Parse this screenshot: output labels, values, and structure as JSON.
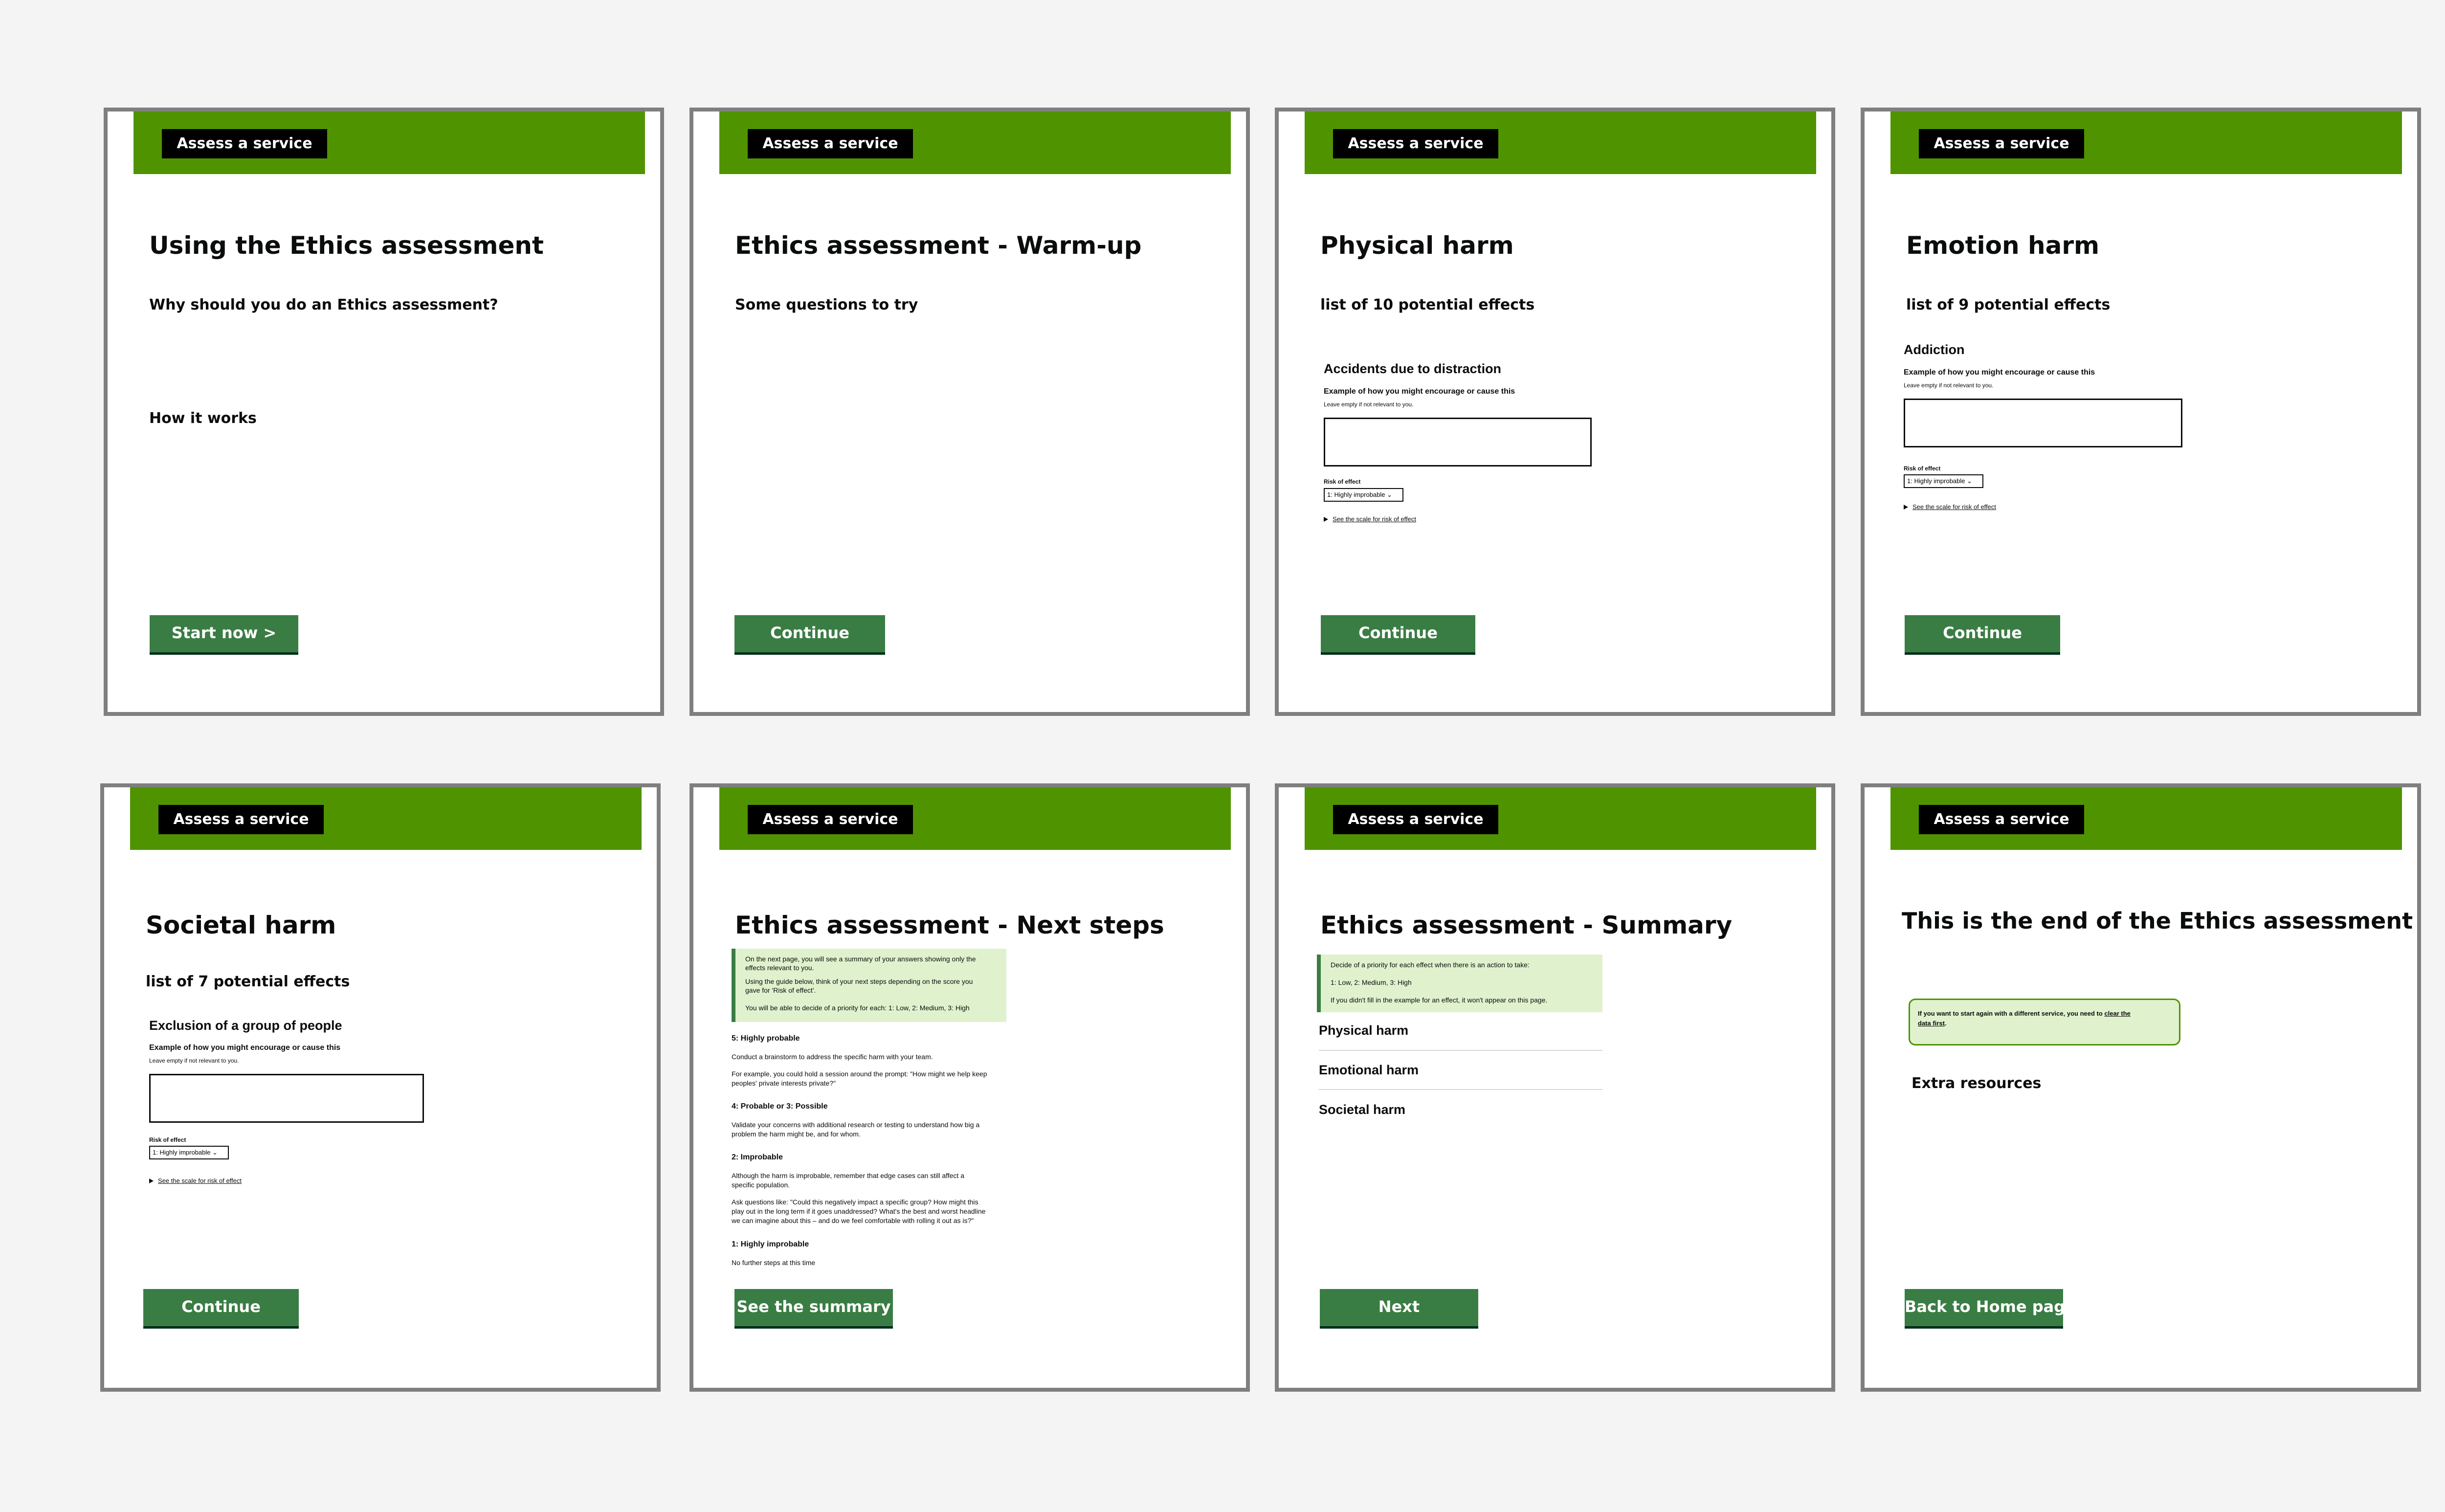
{
  "service_label": "Assess a service",
  "cards": {
    "c1": {
      "title": "Using the Ethics assessment",
      "subtitle": "Why should you do an Ethics assessment?",
      "section": "How it works",
      "button": "Start now >"
    },
    "c2": {
      "title": "Ethics assessment - Warm-up",
      "subtitle": "Some questions to try",
      "button": "Continue"
    },
    "c3": {
      "title": "Physical harm",
      "subtitle": "list of 10 potential effects",
      "effect": "Accidents due to distraction",
      "example_label": "Example of how you might encourage or cause this",
      "hint": "Leave empty if not relevant to you.",
      "risk_label": "Risk of effect",
      "risk_value": "1: Highly improbable",
      "details": "See the scale for risk of effect",
      "button": "Continue"
    },
    "c4": {
      "title": "Emotion harm",
      "subtitle": "list of 9 potential effects",
      "effect": "Addiction",
      "example_label": "Example of how you might encourage or cause this",
      "hint": "Leave empty if not relevant to you.",
      "risk_label": "Risk of effect",
      "risk_value": "1: Highly improbable",
      "details": "See the scale for risk of effect",
      "button": "Continue"
    },
    "c5": {
      "title": "Societal harm",
      "subtitle": "list of 7 potential effects",
      "effect": "Exclusion of a group of people",
      "example_label": "Example of how you might encourage or cause this",
      "hint": "Leave empty if not relevant to you.",
      "risk_label": "Risk of effect",
      "risk_value": "1: Highly improbable",
      "details": "See the scale for risk of effect",
      "button": "Continue"
    },
    "c6": {
      "title": "Ethics assessment - Next steps",
      "inset": [
        "On the next page, you will see a summary of your answers showing only the",
        "effects relevant to you.",
        "Using the guide below, think of your next steps depending on the score you",
        "gave for 'Risk of effect'.",
        "You will be able to decide of a priority for each: 1: Low, 2: Medium, 3: High"
      ],
      "h_highly_probable": "5: Highly probable",
      "p_highly_probable": "Conduct a brainstorm to address the specific harm with your team.",
      "p_example": [
        "For example, you could hold a session around the prompt: \"How might we help keep",
        "peoples' private interests private?\""
      ],
      "h_probable": "4: Probable or 3: Possible",
      "p_probable": [
        "Validate your concerns with additional research or testing to understand how big a",
        "problem the harm might be, and for whom."
      ],
      "h_improbable": "2: Improbable",
      "p_improbable": [
        "Although the harm is improbable, remember that edge cases can still affect a",
        "specific population."
      ],
      "p_ask": [
        "Ask questions like: \"Could this negatively impact a specific group? How might this",
        "play out in the long term if it goes unaddressed? What's the best and worst headline",
        "we can imagine about this – and do we feel comfortable with rolling it out as is?\""
      ],
      "h_highly_improbable": "1: Highly improbable",
      "p_highly_improbable": "No further steps at this time",
      "button": "See the summary"
    },
    "c7": {
      "title": "Ethics assessment - Summary",
      "inset": [
        "Decide of a priority for each effect when there is an action to take:",
        "1: Low, 2: Medium, 3: High",
        "If you didn't fill in the example for an effect, it won't appear on this page."
      ],
      "items": [
        "Physical harm",
        "Emotional harm",
        "Societal harm"
      ],
      "button": "Next"
    },
    "c8": {
      "title": "This is the end of the Ethics assessment",
      "notice": "If you want to start again with a different service, you need to",
      "notice_link_1": "clear the",
      "notice_link_2": "data first",
      "notice_end": ".",
      "section": "Extra resources",
      "button": "Back to Home page"
    }
  }
}
